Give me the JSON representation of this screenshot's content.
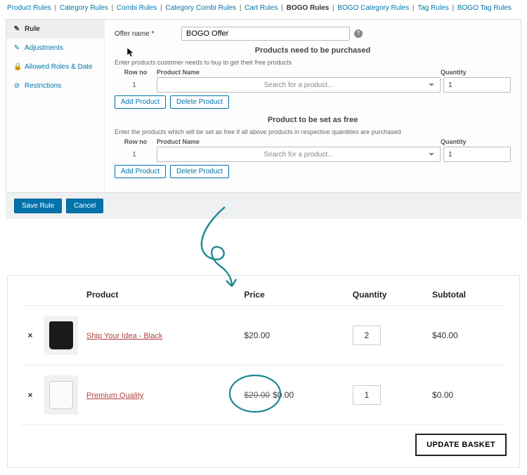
{
  "tabs": {
    "items": [
      "Product Rules",
      "Category Rules",
      "Combi Rules",
      "Category Combi Rules",
      "Cart Rules",
      "BOGO Rules",
      "BOGO Category Rules",
      "Tag Rules",
      "BOGO Tag Rules"
    ],
    "active_index": 5
  },
  "sidebar": {
    "items": [
      {
        "glyph": "✎",
        "label": "Rule",
        "active": true
      },
      {
        "glyph": "✎",
        "label": "Adjustments",
        "active": false
      },
      {
        "glyph": "🔒",
        "label": "Allowed Roles & Date",
        "active": false
      },
      {
        "glyph": "⊘",
        "label": "Restrictions",
        "active": false
      }
    ]
  },
  "form": {
    "offer_name_label": "Offer name *",
    "offer_name_value": "BOGO Offer",
    "purchase": {
      "title": "Products need to be purchased",
      "desc": "Enter products customer needs to buy to get their free products",
      "cols": {
        "rowno": "Row no",
        "name": "Product Name",
        "qty": "Quantity"
      },
      "row": {
        "no": "1",
        "placeholder": "Search for a product...",
        "qty": "1"
      },
      "add": "Add Product",
      "del": "Delete Product"
    },
    "free": {
      "title": "Product to be set as free",
      "desc": "Enter the products which will be set as free if all above products in respective quantities are purchased",
      "cols": {
        "rowno": "Row no",
        "name": "Product Name",
        "qty": "Quantity"
      },
      "row": {
        "no": "1",
        "placeholder": "Search for a product...",
        "qty": "1"
      },
      "add": "Add Product",
      "del": "Delete Product"
    }
  },
  "footer": {
    "save": "Save Rule",
    "cancel": "Cancel"
  },
  "cart": {
    "headers": {
      "product": "Product",
      "price": "Price",
      "qty": "Quantity",
      "subtotal": "Subtotal"
    },
    "rows": [
      {
        "remove": "×",
        "name": "Ship Your Idea - Black",
        "thumb": "black",
        "price": "$20.00",
        "old_price": "",
        "qty": "2",
        "subtotal": "$40.00"
      },
      {
        "remove": "×",
        "name": "Premium Quality",
        "thumb": "white",
        "price": "$0.00",
        "old_price": "$20.00",
        "qty": "1",
        "subtotal": "$0.00"
      }
    ],
    "update": "UPDATE BASKET"
  },
  "colors": {
    "link": "#0073aa",
    "accent": "#1b8a8f",
    "cart_link": "#b04040"
  }
}
